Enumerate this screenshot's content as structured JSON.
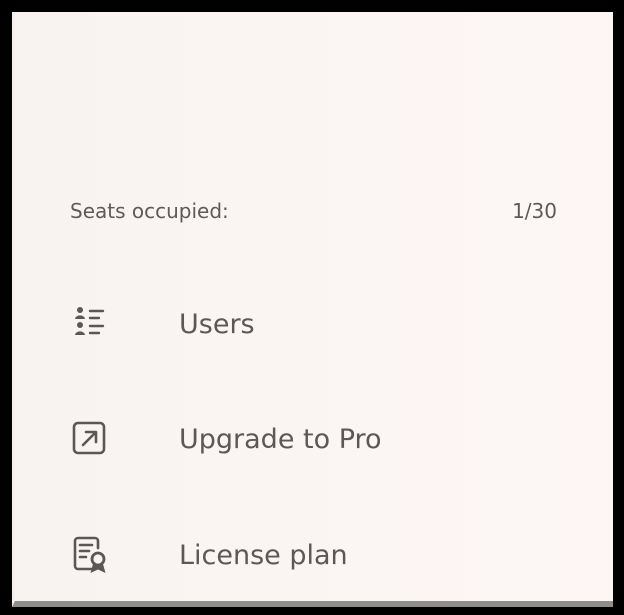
{
  "seats": {
    "label": "Seats occupied:",
    "value": "1/30"
  },
  "menu": {
    "users": {
      "label": "Users",
      "icon": "users-list-icon"
    },
    "upgrade": {
      "label": "Upgrade to Pro",
      "icon": "arrow-up-right-box-icon"
    },
    "license": {
      "label": "License plan",
      "icon": "license-certificate-icon"
    }
  },
  "colors": {
    "text": "#5b5857",
    "icon": "#5a5757",
    "panel_background": "#fbf5f3",
    "frame": "#000000"
  }
}
